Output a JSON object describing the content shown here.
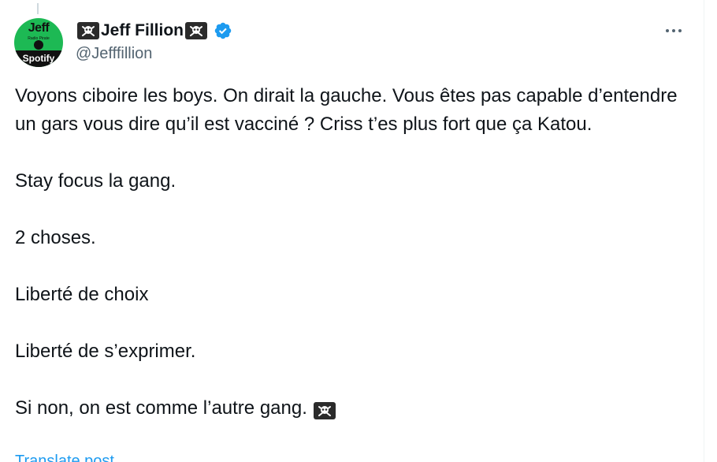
{
  "user": {
    "display_name": "Jeff Fillion",
    "handle": "@Jefffillion",
    "verified": true,
    "name_decoration_icon": "skull-crossbones-icon",
    "avatar": {
      "top_text": "Jeff",
      "mid_text": "Radio   Pirate",
      "bottom_text": "Spotify"
    }
  },
  "tweet": {
    "lines": [
      "Voyons ciboire les boys. On dirait la gauche. Vous êtes pas capable d’entendre un gars vous dire qu’il est vacciné ? Criss t’es plus fort que ça Katou.",
      "",
      "Stay focus la gang.",
      "",
      "2 choses.",
      "",
      "Liberté de choix",
      "",
      "Liberté de s’exprimer.",
      "",
      "Si non, on est comme l’autre gang."
    ],
    "trailing_icon": "skull-crossbones-icon",
    "translate_label": "Translate post"
  },
  "colors": {
    "text": "#0f1419",
    "secondary": "#536471",
    "accent": "#1d9bf0",
    "avatar_green": "#1db954"
  }
}
